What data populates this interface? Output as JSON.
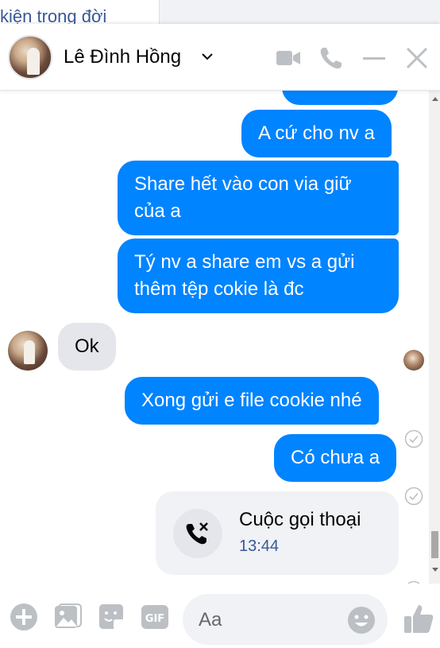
{
  "background": {
    "text": "kiện trong đời"
  },
  "header": {
    "contact_name": "Lê Đình Hồng"
  },
  "messages": [
    {
      "dir": "out",
      "text": ""
    },
    {
      "dir": "out",
      "text": "A cứ cho nv a"
    },
    {
      "dir": "out",
      "line1": "Share hết vào con via giữ",
      "line2": "của a"
    },
    {
      "dir": "out",
      "line1": "Tý nv a share em vs a gửi",
      "line2": "thêm tệp cokie là đc"
    },
    {
      "dir": "in",
      "text": "Ok"
    },
    {
      "dir": "out",
      "text": "Xong gửi e file cookie nhé"
    },
    {
      "dir": "out",
      "text": "Có chưa a"
    }
  ],
  "call": {
    "title": "Cuộc gọi thoại",
    "time": "13:44"
  },
  "composer": {
    "placeholder": "Aa"
  },
  "colors": {
    "accent": "#0084ff",
    "incoming": "#e4e6eb",
    "icon": "#bcc0c4"
  },
  "icons": [
    "video-call-icon",
    "phone-icon",
    "minimize-icon",
    "close-icon",
    "plus-icon",
    "photo-icon",
    "sticker-icon",
    "gif-icon",
    "emoji-icon",
    "like-icon",
    "missed-call-icon",
    "seen-check-icon"
  ]
}
